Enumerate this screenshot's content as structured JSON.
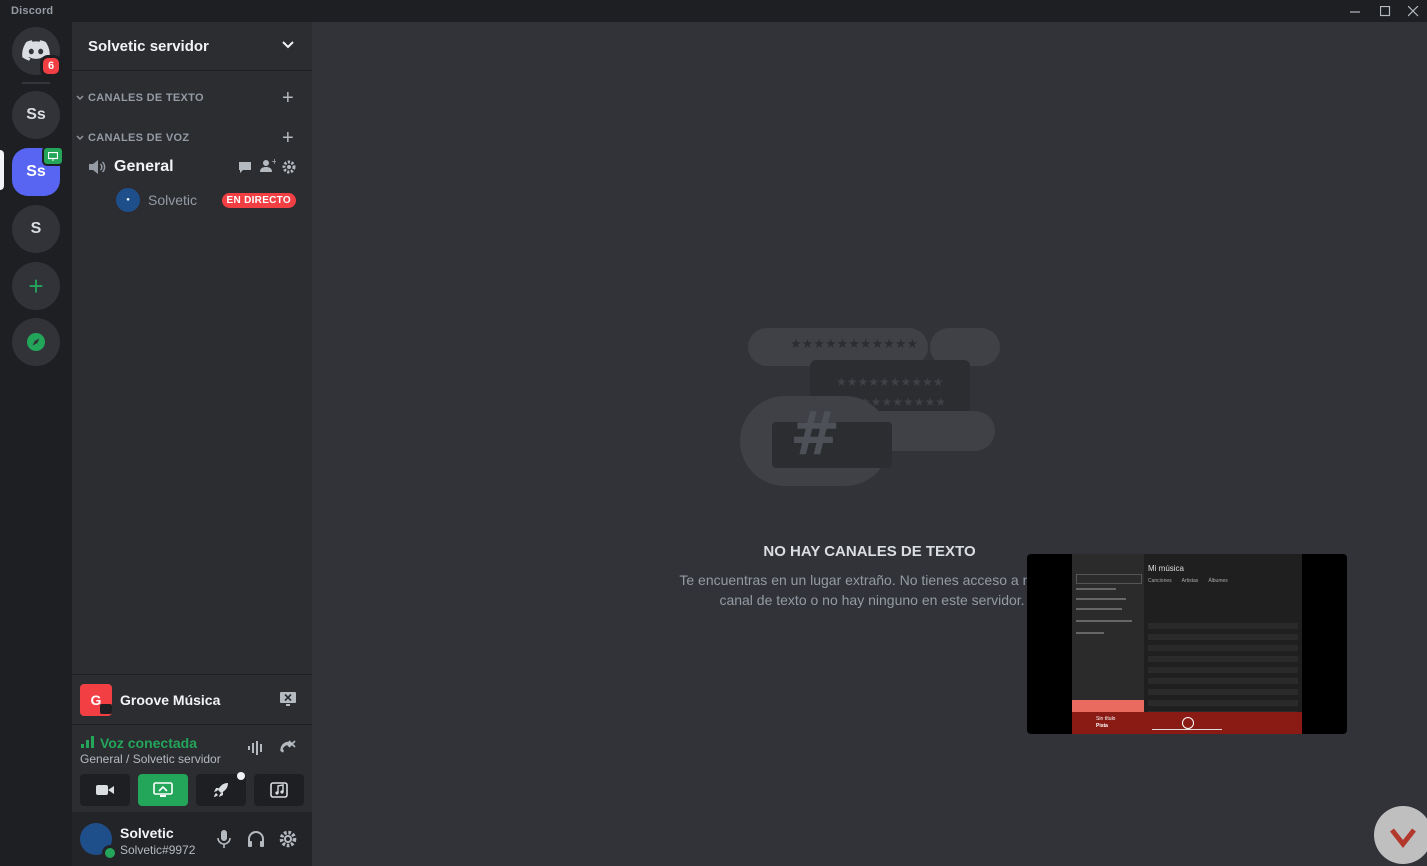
{
  "window": {
    "app_name": "Discord",
    "controls": {
      "minimize": "—",
      "maximize": "☐",
      "close": "✕"
    }
  },
  "rail": {
    "home_badge": "6",
    "servers": [
      {
        "label": "Ss"
      },
      {
        "label": "Ss"
      },
      {
        "label": "S"
      }
    ],
    "add_symbol": "+"
  },
  "sidebar": {
    "guild_name": "Solvetic servidor",
    "categories": [
      {
        "label": "CANALES DE TEXTO"
      },
      {
        "label": "CANALES DE VOZ"
      }
    ],
    "voice_channel": {
      "name": "General"
    },
    "voice_user": {
      "name": "Solvetic",
      "live_label": "EN DIRECTO"
    }
  },
  "activity": {
    "icon_letter": "G",
    "name": "Groove Música"
  },
  "voice_panel": {
    "status": "Voz conectada",
    "location": "General / Solvetic servidor"
  },
  "user": {
    "name": "Solvetic",
    "tag": "Solvetic#9972"
  },
  "main": {
    "empty_title": "NO HAY CANALES DE TEXTO",
    "empty_desc": "Te encuentras en un lugar extraño. No tienes acceso a ningún canal de texto o no hay ninguno en este servidor."
  },
  "stream_preview": {
    "app_title": "Mi música",
    "tabs": [
      "Canciones",
      "Artistas",
      "Álbumes"
    ],
    "now_playing": {
      "title": "Sin título",
      "artist": "Pista"
    }
  },
  "colors": {
    "blurple": "#5865f2",
    "green": "#23a55a",
    "red": "#f23f43",
    "background": "#313338",
    "sidebar": "#2b2d31",
    "rail": "#1e1f22"
  }
}
